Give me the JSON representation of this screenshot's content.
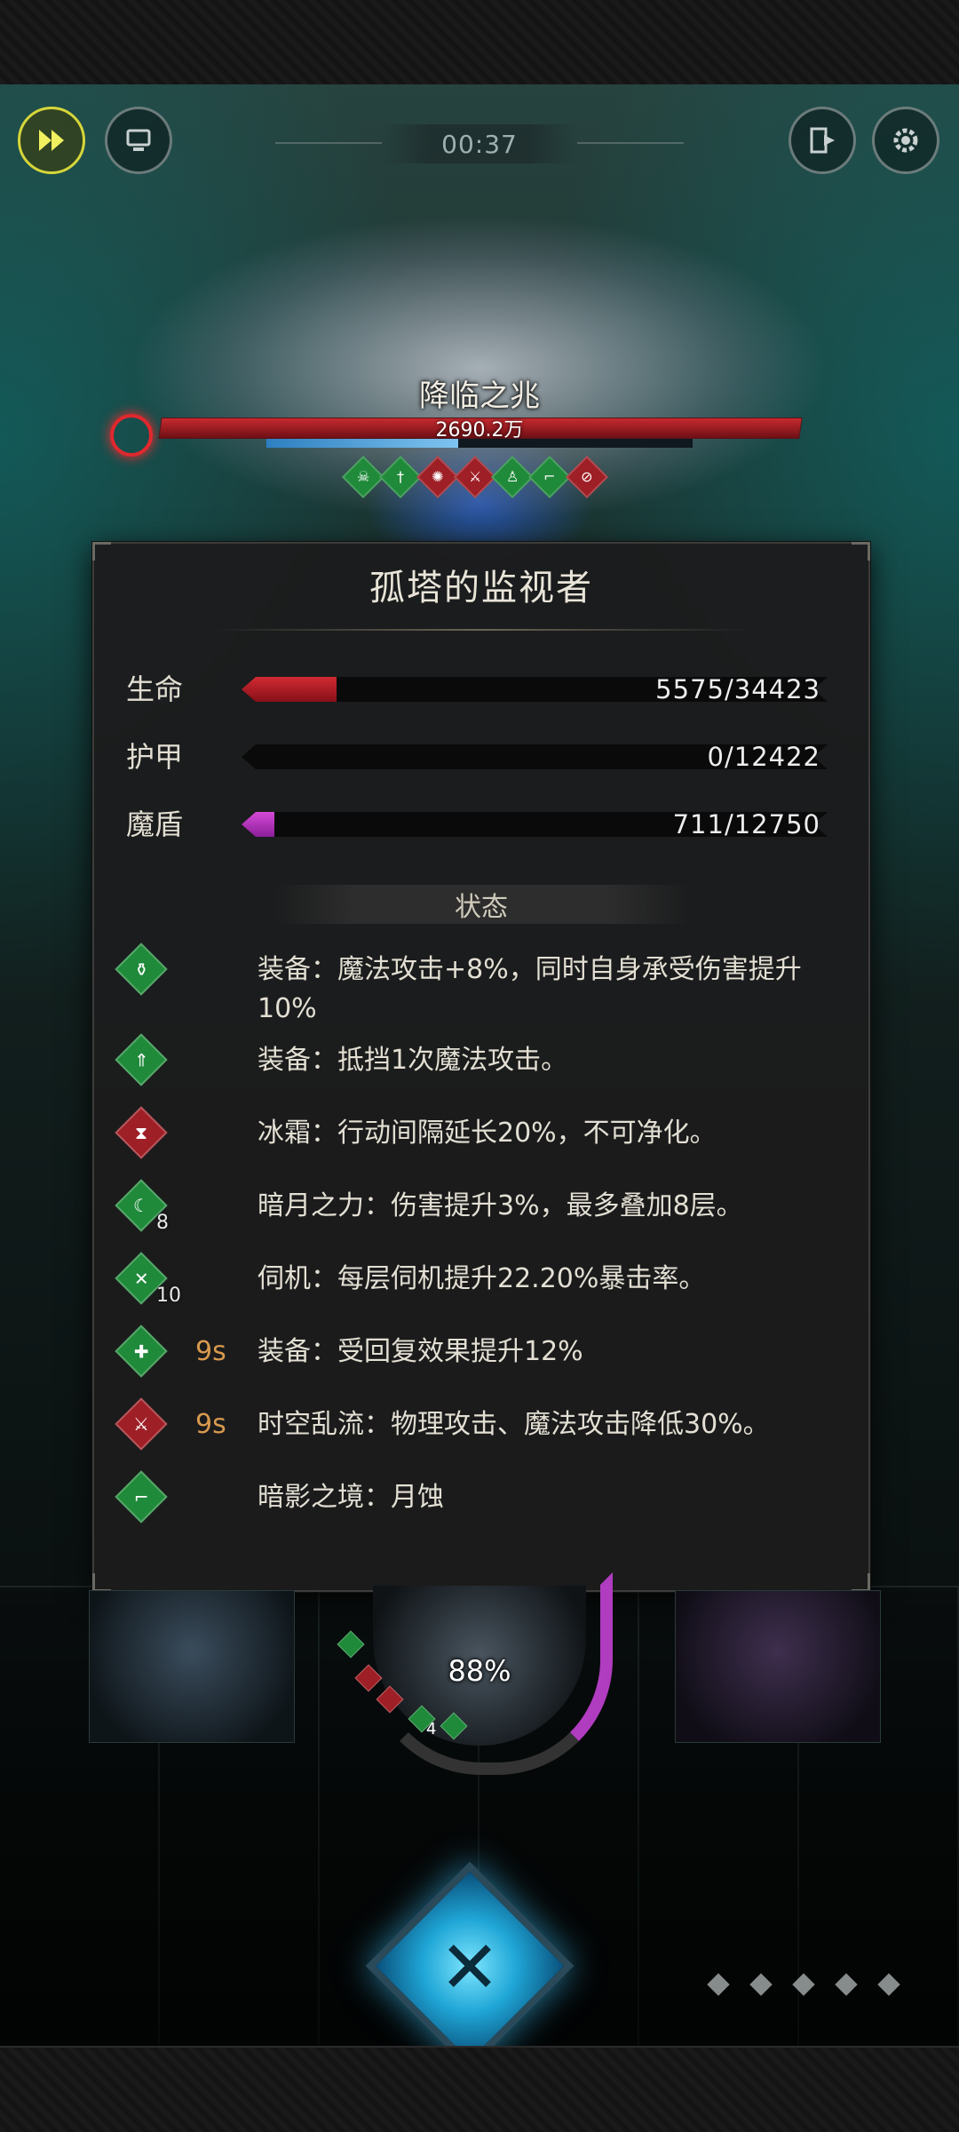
{
  "hud": {
    "timer": "00:37",
    "speed_icon": "fast-forward-icon",
    "auto_icon": "auto-battle-icon",
    "exit_icon": "exit-icon",
    "settings_icon": "gear-icon"
  },
  "boss": {
    "name": "降临之兆",
    "hp_text": "2690.2万",
    "hp_fraction": 1.0,
    "bar_color": "#c62a2f",
    "buff_icons": [
      {
        "icon": "skull-icon",
        "color": "green"
      },
      {
        "icon": "sword-icon",
        "color": "green"
      },
      {
        "icon": "flame-icon",
        "color": "red"
      },
      {
        "icon": "broken-sword-icon",
        "color": "red"
      },
      {
        "icon": "figure-icon",
        "color": "green"
      },
      {
        "icon": "boot-icon",
        "color": "green"
      },
      {
        "icon": "forbid-icon",
        "color": "red"
      }
    ]
  },
  "panel": {
    "title": "孤塔的监视者",
    "stats": [
      {
        "label": "生命",
        "value_text": "5575/34423",
        "current": 5575,
        "max": 34423,
        "type": "hp",
        "color": "#d22a33"
      },
      {
        "label": "护甲",
        "value_text": "0/12422",
        "current": 0,
        "max": 12422,
        "type": "armor",
        "color": "#777777"
      },
      {
        "label": "魔盾",
        "value_text": "711/12750",
        "current": 711,
        "max": 12750,
        "type": "mana",
        "color": "#d64ad6"
      }
    ],
    "status_header": "状态",
    "statuses": [
      {
        "icon": "potion-icon",
        "color": "green",
        "stack": "",
        "duration": "",
        "text": "装备：魔法攻击+8%，同时自身承受伤害提升10%"
      },
      {
        "icon": "shield-up-icon",
        "color": "green",
        "stack": "",
        "duration": "",
        "text": "装备：抵挡1次魔法攻击。"
      },
      {
        "icon": "hourglass-icon",
        "color": "red",
        "stack": "",
        "duration": "",
        "text": "冰霜：行动间隔延长20%，不可净化。"
      },
      {
        "icon": "crescent-moon-icon",
        "color": "green",
        "stack": "8",
        "duration": "",
        "text": "暗月之力：伤害提升3%，最多叠加8层。"
      },
      {
        "icon": "crossed-blades-icon",
        "color": "green",
        "stack": "10",
        "duration": "",
        "text": "伺机：每层伺机提升22.20%暴击率。"
      },
      {
        "icon": "heal-cross-icon",
        "color": "green",
        "stack": "",
        "duration": "9s",
        "text": "装备：受回复效果提升12%"
      },
      {
        "icon": "broken-sword-icon",
        "color": "red",
        "stack": "",
        "duration": "9s",
        "text": "时空乱流：物理攻击、魔法攻击降低30%。"
      },
      {
        "icon": "boot-icon",
        "color": "green",
        "stack": "",
        "duration": "",
        "text": "暗影之境：月蚀"
      }
    ]
  },
  "hero": {
    "percent_text": "88%",
    "percent": 88,
    "mini_stack": "4"
  },
  "skill": {
    "icon": "crossed-swords-icon",
    "color": "#1fa6d6"
  },
  "pager": {
    "count": 5
  }
}
